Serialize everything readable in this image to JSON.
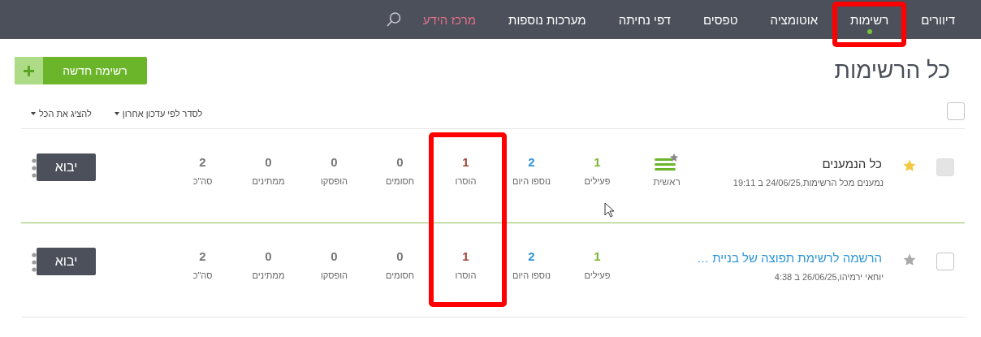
{
  "nav": {
    "items": [
      {
        "label": "דיוורים",
        "kind": "link",
        "selected": false,
        "highlighted": false
      },
      {
        "label": "רשימות",
        "kind": "link",
        "selected": true,
        "highlighted": true
      },
      {
        "label": "אוטומציה",
        "kind": "link",
        "selected": false,
        "highlighted": false
      },
      {
        "label": "טפסים",
        "kind": "link",
        "selected": false,
        "highlighted": false
      },
      {
        "label": "דפי נחיתה",
        "kind": "link",
        "selected": false,
        "highlighted": false
      },
      {
        "label": "מערכות נוספות",
        "kind": "link",
        "selected": false,
        "highlighted": false
      },
      {
        "label": "מרכז הידע",
        "kind": "help",
        "selected": false,
        "highlighted": false
      }
    ]
  },
  "page": {
    "title": "כל הרשימות",
    "new_button": "רשימה חדשה"
  },
  "toolbar": {
    "sort": "לסדר לפי עדכון אחרון",
    "filter": "להציג את הכל",
    "select_all_checked": false
  },
  "removed_column_highlighted": true,
  "rows": [
    {
      "checked": false,
      "disabled": true,
      "favorite": true,
      "title": "כל הנמענים",
      "is_link": false,
      "subtitle": "נמענים מכל הרשימות,24/06/25 ב 19:11",
      "main_label": "ראשית",
      "import": "יבוא",
      "stats": [
        {
          "kind": "active",
          "value": "1",
          "label": "פעילים"
        },
        {
          "kind": "added",
          "value": "2",
          "label": "נוספו היום"
        },
        {
          "kind": "removed",
          "value": "1",
          "label": "הוסרו"
        },
        {
          "kind": "blocked",
          "value": "0",
          "label": "חסומים"
        },
        {
          "kind": "stopped",
          "value": "0",
          "label": "הופסקו"
        },
        {
          "kind": "waiting",
          "value": "0",
          "label": "ממתינים"
        },
        {
          "kind": "total",
          "value": "2",
          "label": "סה\"כ"
        }
      ]
    },
    {
      "checked": false,
      "disabled": false,
      "favorite": false,
      "title": "הרשמה לרשימת תפוצה של בניית …",
      "is_link": true,
      "subtitle": "יוחאי ירמיהו,26/06/25 ב 4:38",
      "import": "יבוא",
      "stats": [
        {
          "kind": "active",
          "value": "1",
          "label": "פעילים"
        },
        {
          "kind": "added",
          "value": "2",
          "label": "נוספו היום"
        },
        {
          "kind": "removed",
          "value": "1",
          "label": "הוסרו"
        },
        {
          "kind": "blocked",
          "value": "0",
          "label": "חסומים"
        },
        {
          "kind": "stopped",
          "value": "0",
          "label": "הופסקו"
        },
        {
          "kind": "waiting",
          "value": "0",
          "label": "ממתינים"
        },
        {
          "kind": "total",
          "value": "2",
          "label": "סה\"כ"
        }
      ]
    }
  ]
}
